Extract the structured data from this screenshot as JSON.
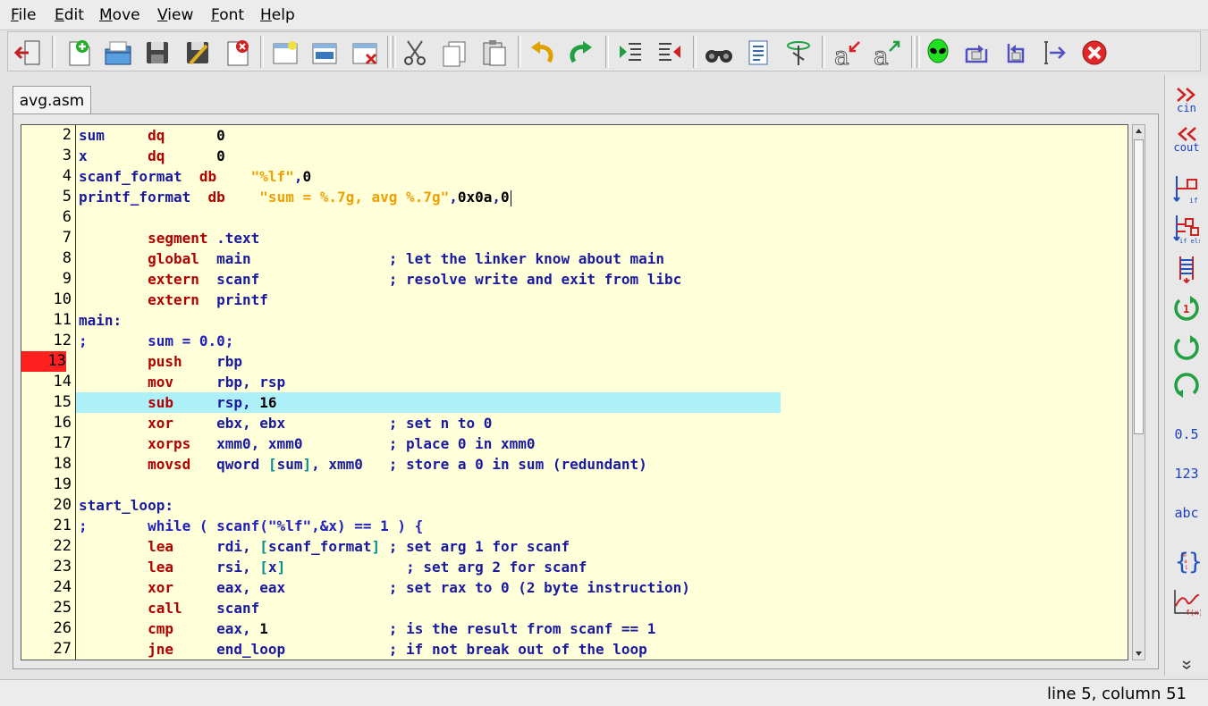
{
  "menu": [
    "File",
    "Edit",
    "Move",
    "View",
    "Font",
    "Help"
  ],
  "menu_mnemonics": [
    "F",
    "E",
    "M",
    "V",
    "F",
    "H"
  ],
  "toolbar_icons": [
    "quit-icon",
    "new-file-icon",
    "open-icon",
    "save-icon",
    "save-as-icon",
    "close-file-icon",
    "new-project-icon",
    "open-project-icon",
    "close-project-icon",
    "cut-icon",
    "copy-icon",
    "paste-icon",
    "undo-icon",
    "redo-icon",
    "indent-icon",
    "unindent-icon",
    "find-icon",
    "find-replace-icon",
    "goto-icon",
    "font-smaller-icon",
    "font-larger-icon",
    "alien-run-icon",
    "step-over-icon",
    "step-into-icon",
    "continue-icon",
    "stop-icon"
  ],
  "tab": {
    "label": "avg.asm"
  },
  "side_labels": {
    "cin": "cin",
    "cout": "cout",
    "float": "0.5",
    "int": "123",
    "str": "abc"
  },
  "status": {
    "position": "line 5, column 51"
  },
  "editor": {
    "breakpoint_line": "13",
    "highlight_line": "15",
    "lines": [
      {
        "n": "2",
        "t": [
          [
            "sum     ",
            "id"
          ],
          [
            "dq      ",
            "kw"
          ],
          [
            "0",
            "num"
          ]
        ]
      },
      {
        "n": "3",
        "t": [
          [
            "x       ",
            "id"
          ],
          [
            "dq      ",
            "kw"
          ],
          [
            "0",
            "num"
          ]
        ]
      },
      {
        "n": "4",
        "t": [
          [
            "scanf_format  ",
            "id"
          ],
          [
            "db    ",
            "kw"
          ],
          [
            "\"%lf\"",
            "str"
          ],
          [
            ",",
            "id"
          ],
          [
            "0",
            "num"
          ]
        ]
      },
      {
        "n": "5",
        "t": [
          [
            "printf_format  ",
            "id"
          ],
          [
            "db    ",
            "kw"
          ],
          [
            "\"sum = %.7g, avg %.7g\"",
            "str"
          ],
          [
            ",",
            "id"
          ],
          [
            "0x0a",
            "num"
          ],
          [
            ",",
            "id"
          ],
          [
            "0",
            "num"
          ]
        ]
      },
      {
        "n": "6",
        "t": []
      },
      {
        "n": "7",
        "t": [
          [
            "        ",
            "id"
          ],
          [
            "segment ",
            "kw"
          ],
          [
            ".text",
            "id"
          ]
        ]
      },
      {
        "n": "8",
        "t": [
          [
            "        ",
            "id"
          ],
          [
            "global  ",
            "kw"
          ],
          [
            "main                ; let the linker know about main",
            "id"
          ]
        ]
      },
      {
        "n": "9",
        "t": [
          [
            "        ",
            "id"
          ],
          [
            "extern  ",
            "kw"
          ],
          [
            "scanf               ; resolve write and exit from libc",
            "id"
          ]
        ]
      },
      {
        "n": "10",
        "t": [
          [
            "        ",
            "id"
          ],
          [
            "extern  ",
            "kw"
          ],
          [
            "printf",
            "id"
          ]
        ]
      },
      {
        "n": "11",
        "t": [
          [
            "main:",
            "id"
          ]
        ]
      },
      {
        "n": "12",
        "t": [
          [
            ";       sum = 0.0;",
            "cm"
          ]
        ]
      },
      {
        "n": "13",
        "t": [
          [
            "        ",
            "id"
          ],
          [
            "push    ",
            "kw"
          ],
          [
            "rbp",
            "id"
          ]
        ]
      },
      {
        "n": "14",
        "t": [
          [
            "        ",
            "id"
          ],
          [
            "mov     ",
            "kw"
          ],
          [
            "rbp, rsp",
            "id"
          ]
        ]
      },
      {
        "n": "15",
        "t": [
          [
            "        ",
            "id"
          ],
          [
            "sub     ",
            "kw"
          ],
          [
            "rsp, ",
            "id"
          ],
          [
            "16",
            "num"
          ]
        ]
      },
      {
        "n": "16",
        "t": [
          [
            "        ",
            "id"
          ],
          [
            "xor     ",
            "kw"
          ],
          [
            "ebx, ebx            ; set n to 0",
            "id"
          ]
        ]
      },
      {
        "n": "17",
        "t": [
          [
            "        ",
            "id"
          ],
          [
            "xorps   ",
            "kw"
          ],
          [
            "xmm0, xmm0          ; place 0 in xmm0",
            "id"
          ]
        ]
      },
      {
        "n": "18",
        "t": [
          [
            "        ",
            "id"
          ],
          [
            "movsd   ",
            "kw"
          ],
          [
            "qword ",
            "id"
          ],
          [
            "[",
            "br"
          ],
          [
            "sum",
            "id"
          ],
          [
            "]",
            "br"
          ],
          [
            ", xmm0   ; store a 0 in sum (redundant)",
            "id"
          ]
        ]
      },
      {
        "n": "19",
        "t": []
      },
      {
        "n": "20",
        "t": [
          [
            "start_loop:",
            "id"
          ]
        ]
      },
      {
        "n": "21",
        "t": [
          [
            ";       while ( scanf(\"%lf\",&x) == 1 ) {",
            "cm"
          ]
        ]
      },
      {
        "n": "22",
        "t": [
          [
            "        ",
            "id"
          ],
          [
            "lea     ",
            "kw"
          ],
          [
            "rdi, ",
            "id"
          ],
          [
            "[",
            "br"
          ],
          [
            "scanf_format",
            "id"
          ],
          [
            "]",
            "br"
          ],
          [
            " ; set arg 1 for scanf",
            "id"
          ]
        ]
      },
      {
        "n": "23",
        "t": [
          [
            "        ",
            "id"
          ],
          [
            "lea     ",
            "kw"
          ],
          [
            "rsi, ",
            "id"
          ],
          [
            "[",
            "br"
          ],
          [
            "x",
            "id"
          ],
          [
            "]",
            "br"
          ],
          [
            "              ; set arg 2 for scanf",
            "id"
          ]
        ]
      },
      {
        "n": "24",
        "t": [
          [
            "        ",
            "id"
          ],
          [
            "xor     ",
            "kw"
          ],
          [
            "eax, eax            ; set rax to 0 (2 byte instruction)",
            "id"
          ]
        ]
      },
      {
        "n": "25",
        "t": [
          [
            "        ",
            "id"
          ],
          [
            "call    ",
            "kw"
          ],
          [
            "scanf",
            "id"
          ]
        ]
      },
      {
        "n": "26",
        "t": [
          [
            "        ",
            "id"
          ],
          [
            "cmp     ",
            "kw"
          ],
          [
            "eax, ",
            "id"
          ],
          [
            "1",
            "num"
          ],
          [
            "              ; is the result from scanf == 1",
            "id"
          ]
        ]
      },
      {
        "n": "27",
        "t": [
          [
            "        ",
            "id"
          ],
          [
            "jne     ",
            "kw"
          ],
          [
            "end_loop            ; if not break out of the loop",
            "id"
          ]
        ]
      }
    ]
  }
}
